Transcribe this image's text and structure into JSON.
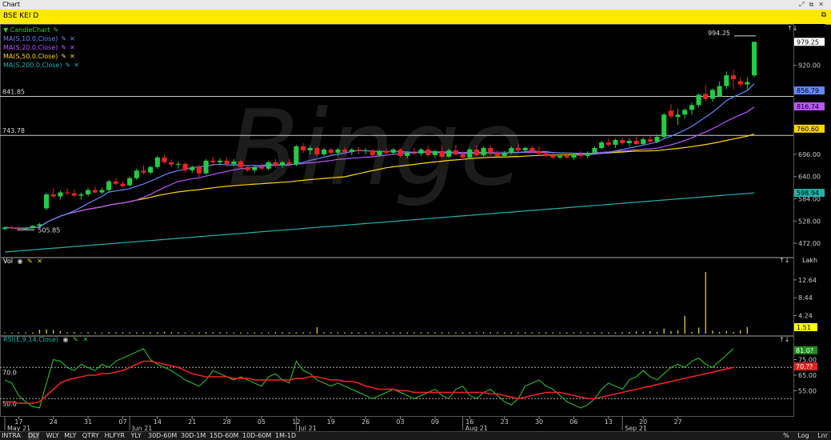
{
  "window": {
    "title": "Chart",
    "controls": [
      "⤢",
      "⧉",
      "✕"
    ]
  },
  "symbol_bar": {
    "title": "BSE KEI D",
    "restore_icon": "restore-icon"
  },
  "price_panel": {
    "legend": [
      {
        "label": "CandleChart",
        "color": "#33cc33"
      },
      {
        "label": "MA(S,10.0,Close)",
        "color": "#6688ff"
      },
      {
        "label": "MA(S,20.0,Close)",
        "color": "#bb55ff"
      },
      {
        "label": "MA(S,50.0,Close)",
        "color": "#ffd700"
      },
      {
        "label": "MA(S,200.0,Close)",
        "color": "#20b2aa"
      }
    ],
    "hlines": [
      {
        "label": "841.85",
        "value": 841.85
      },
      {
        "label": "743.78",
        "value": 743.78
      }
    ],
    "annotations": {
      "high": "994.25",
      "low": "505.85"
    },
    "tags": [
      {
        "text": "979.25",
        "value": 979.25,
        "bg": "#ffffff",
        "fg": "#000000"
      },
      {
        "text": "856.79",
        "value": 856.79,
        "bg": "#6688ff",
        "fg": "#000000"
      },
      {
        "text": "816.74",
        "value": 816.74,
        "bg": "#bb55ff",
        "fg": "#000000"
      },
      {
        "text": "760.60",
        "value": 760.6,
        "bg": "#ffd700",
        "fg": "#000000"
      },
      {
        "text": "598.94",
        "value": 598.94,
        "bg": "#20b2aa",
        "fg": "#000000"
      }
    ],
    "watermark": "Binge"
  },
  "volume_panel": {
    "label": "Vol",
    "unit": "Lakh",
    "tag": "1.51"
  },
  "rsi_panel": {
    "label": "RSI(E,9,14,Close)",
    "tag_rsi": "81.0?",
    "tag_signal": "70.??"
  },
  "date_axis": {
    "months": [
      {
        "label": "May 21",
        "i": 0
      },
      {
        "label": "Jun 21",
        "i": 18
      },
      {
        "label": "Jul 21",
        "i": 42
      },
      {
        "label": "Aug 21",
        "i": 66
      },
      {
        "label": "Sep 21",
        "i": 89
      }
    ],
    "days": [
      "17",
      "24",
      "31",
      "07",
      "14",
      "21",
      "28",
      "05",
      "12",
      "19",
      "26",
      "03",
      "09",
      "16",
      "23",
      "30",
      "06",
      "13",
      "20",
      "27"
    ]
  },
  "bottom_bar": {
    "periods": [
      "INTRA",
      "DLY",
      "WLY",
      "MLY",
      "QTRY",
      "HLFYR",
      "YLY"
    ],
    "selected": "DLY",
    "intervals": [
      "30D-60M",
      "30D-1M",
      "15D-60M",
      "10D-60M",
      "1M-1D"
    ],
    "right": [
      "%",
      "Log",
      "Lnr"
    ]
  },
  "chart_data": {
    "type": "candlestick",
    "title": "BSE KEI D",
    "ylim": [
      440,
      1000
    ],
    "y_ticks": [
      472.0,
      528.0,
      584.0,
      640.0,
      696.0,
      920.0
    ],
    "candles": [
      [
        508,
        514,
        505,
        512
      ],
      [
        512,
        516,
        507,
        510
      ],
      [
        510,
        515,
        505.85,
        508
      ],
      [
        508,
        512,
        506,
        511
      ],
      [
        511,
        518,
        509,
        516
      ],
      [
        516,
        523,
        513,
        520
      ],
      [
        560,
        600,
        555,
        595
      ],
      [
        595,
        610,
        585,
        590
      ],
      [
        590,
        605,
        582,
        600
      ],
      [
        600,
        610,
        592,
        598
      ],
      [
        598,
        608,
        588,
        592
      ],
      [
        592,
        600,
        582,
        595
      ],
      [
        595,
        612,
        590,
        606
      ],
      [
        606,
        615,
        598,
        600
      ],
      [
        600,
        612,
        595,
        606
      ],
      [
        606,
        632,
        602,
        628
      ],
      [
        628,
        636,
        618,
        622
      ],
      [
        622,
        628,
        612,
        616
      ],
      [
        618,
        640,
        615,
        636
      ],
      [
        636,
        660,
        632,
        655
      ],
      [
        655,
        668,
        645,
        650
      ],
      [
        650,
        668,
        645,
        664
      ],
      [
        664,
        692,
        660,
        688
      ],
      [
        688,
        694,
        672,
        676
      ],
      [
        676,
        684,
        664,
        670
      ],
      [
        670,
        678,
        660,
        672
      ],
      [
        672,
        676,
        650,
        656
      ],
      [
        656,
        668,
        650,
        664
      ],
      [
        664,
        670,
        640,
        648
      ],
      [
        648,
        684,
        645,
        680
      ],
      [
        680,
        690,
        670,
        676
      ],
      [
        676,
        686,
        668,
        680
      ],
      [
        680,
        688,
        666,
        672
      ],
      [
        672,
        684,
        666,
        678
      ],
      [
        678,
        682,
        660,
        664
      ],
      [
        664,
        670,
        652,
        656
      ],
      [
        656,
        668,
        650,
        664
      ],
      [
        664,
        672,
        656,
        660
      ],
      [
        660,
        680,
        656,
        676
      ],
      [
        676,
        684,
        664,
        668
      ],
      [
        668,
        680,
        662,
        676
      ],
      [
        676,
        684,
        666,
        672
      ],
      [
        670,
        720,
        666,
        716
      ],
      [
        716,
        724,
        700,
        706
      ],
      [
        706,
        718,
        696,
        712
      ],
      [
        712,
        716,
        690,
        696
      ],
      [
        696,
        712,
        692,
        708
      ],
      [
        708,
        712,
        694,
        700
      ],
      [
        700,
        712,
        692,
        708
      ],
      [
        708,
        714,
        696,
        702
      ],
      [
        702,
        712,
        694,
        708
      ],
      [
        708,
        714,
        696,
        704
      ],
      [
        704,
        712,
        696,
        706
      ],
      [
        706,
        710,
        690,
        694
      ],
      [
        694,
        708,
        690,
        704
      ],
      [
        704,
        712,
        696,
        700
      ],
      [
        700,
        712,
        694,
        708
      ],
      [
        708,
        712,
        688,
        692
      ],
      [
        692,
        704,
        686,
        700
      ],
      [
        700,
        712,
        694,
        698
      ],
      [
        698,
        712,
        692,
        708
      ],
      [
        708,
        718,
        690,
        694
      ],
      [
        694,
        708,
        686,
        704
      ],
      [
        704,
        718,
        686,
        690
      ],
      [
        690,
        710,
        688,
        706
      ],
      [
        706,
        720,
        692,
        696
      ],
      [
        696,
        704,
        680,
        688
      ],
      [
        688,
        712,
        686,
        708
      ],
      [
        708,
        718,
        690,
        694
      ],
      [
        694,
        716,
        690,
        712
      ],
      [
        712,
        718,
        694,
        700
      ],
      [
        700,
        704,
        690,
        692
      ],
      [
        692,
        704,
        688,
        700
      ],
      [
        700,
        716,
        696,
        712
      ],
      [
        712,
        722,
        702,
        706
      ],
      [
        706,
        716,
        700,
        712
      ],
      [
        712,
        718,
        700,
        704
      ],
      [
        704,
        716,
        696,
        698
      ],
      [
        698,
        706,
        688,
        692
      ],
      [
        692,
        700,
        684,
        688
      ],
      [
        688,
        696,
        684,
        692
      ],
      [
        692,
        700,
        684,
        688
      ],
      [
        688,
        700,
        682,
        696
      ],
      [
        696,
        704,
        686,
        692
      ],
      [
        692,
        704,
        686,
        700
      ],
      [
        700,
        716,
        696,
        712
      ],
      [
        712,
        730,
        708,
        726
      ],
      [
        726,
        736,
        716,
        720
      ],
      [
        720,
        736,
        712,
        732
      ],
      [
        732,
        738,
        718,
        724
      ],
      [
        724,
        736,
        716,
        730
      ],
      [
        730,
        740,
        720,
        722
      ],
      [
        722,
        738,
        718,
        734
      ],
      [
        734,
        746,
        722,
        728
      ],
      [
        728,
        746,
        724,
        740
      ],
      [
        740,
        800,
        736,
        796
      ],
      [
        806,
        822,
        786,
        792
      ],
      [
        790,
        810,
        770,
        796
      ],
      [
        796,
        812,
        786,
        808
      ],
      [
        808,
        826,
        796,
        820
      ],
      [
        820,
        850,
        814,
        846
      ],
      [
        848,
        870,
        830,
        836
      ],
      [
        836,
        862,
        828,
        858
      ],
      [
        842,
        880,
        840,
        868
      ],
      [
        868,
        905,
        860,
        895
      ],
      [
        895,
        910,
        860,
        885
      ],
      [
        880,
        890,
        865,
        872
      ],
      [
        872,
        890,
        860,
        878
      ],
      [
        895,
        980,
        890,
        979.25
      ]
    ],
    "volume": [
      0.25,
      0.22,
      0.3,
      0.28,
      0.26,
      0.9,
      0.95,
      0.85,
      0.6,
      0.3,
      0.4,
      0.2,
      0.3,
      0.28,
      0.25,
      0.35,
      0.3,
      0.3,
      0.28,
      0.3,
      0.3,
      0.3,
      0.35,
      0.4,
      0.3,
      0.3,
      0.25,
      0.25,
      0.3,
      0.35,
      0.3,
      0.3,
      0.28,
      0.25,
      0.3,
      0.25,
      0.28,
      0.25,
      0.25,
      0.3,
      0.3,
      0.3,
      0.3,
      0.3,
      0.3,
      1.5,
      0.3,
      0.3,
      0.3,
      0.3,
      0.3,
      0.3,
      0.3,
      0.3,
      0.25,
      0.3,
      0.3,
      0.3,
      0.3,
      0.3,
      0.3,
      0.3,
      0.3,
      0.3,
      0.3,
      0.3,
      0.3,
      0.3,
      0.3,
      0.3,
      0.3,
      0.3,
      0.3,
      0.3,
      0.3,
      0.3,
      0.3,
      0.3,
      0.3,
      0.3,
      0.3,
      0.3,
      0.3,
      0.3,
      0.3,
      0.3,
      0.3,
      0.3,
      0.3,
      0.3,
      0.4,
      0.5,
      0.4,
      0.6,
      0.4,
      1.2,
      0.6,
      0.8,
      4.2,
      0.4,
      1.4,
      14.5,
      0.7,
      0.4,
      0.6,
      0.4,
      0.8,
      1.51
    ],
    "volume_ticks": [
      4.24,
      8.44,
      12.64
    ],
    "volume_ylim": [
      0,
      16
    ],
    "rsi": [
      62,
      60,
      52,
      48,
      45,
      44,
      60,
      75,
      74,
      70,
      68,
      72,
      70,
      68,
      72,
      70,
      74,
      76,
      78,
      80,
      82,
      75,
      72,
      70,
      68,
      65,
      62,
      60,
      58,
      62,
      68,
      66,
      64,
      62,
      64,
      62,
      60,
      58,
      64,
      66,
      62,
      60,
      74,
      68,
      66,
      62,
      60,
      58,
      60,
      58,
      56,
      54,
      52,
      50,
      52,
      54,
      56,
      54,
      52,
      50,
      52,
      54,
      56,
      52,
      50,
      56,
      58,
      52,
      50,
      54,
      56,
      52,
      48,
      46,
      50,
      58,
      60,
      62,
      58,
      56,
      52,
      48,
      46,
      44,
      46,
      50,
      56,
      60,
      58,
      56,
      62,
      64,
      68,
      64,
      62,
      66,
      70,
      72,
      70,
      74,
      76,
      72,
      70,
      74,
      78,
      82
    ],
    "rsi_signal": [
      48,
      48,
      47,
      47,
      47,
      48,
      52,
      56,
      60,
      62,
      63,
      64,
      65,
      65,
      66,
      66,
      67,
      68,
      70,
      72,
      74,
      74,
      73,
      72,
      71,
      70,
      68,
      66,
      65,
      64,
      64,
      64,
      64,
      63,
      63,
      63,
      62,
      62,
      62,
      62,
      62,
      62,
      63,
      63,
      64,
      64,
      63,
      62,
      62,
      61,
      61,
      60,
      58,
      57,
      56,
      56,
      56,
      55,
      55,
      54,
      54,
      54,
      54,
      54,
      54,
      54,
      54,
      54,
      54,
      54,
      53,
      53,
      52,
      51,
      50,
      51,
      52,
      53,
      54,
      54,
      54,
      53,
      52,
      51,
      50,
      50,
      51,
      52,
      53,
      54,
      55,
      56,
      57,
      58,
      59,
      60,
      61,
      62,
      63,
      64,
      65,
      66,
      67,
      68,
      69,
      70
    ],
    "rsi_ylim": [
      44,
      85
    ],
    "rsi_ticks": [
      55.0,
      65.0,
      75.0
    ],
    "rsi_levels": [
      70.0,
      50.0
    ]
  }
}
